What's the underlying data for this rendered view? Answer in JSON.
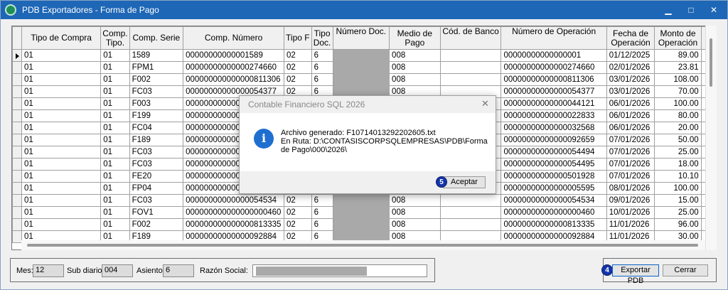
{
  "window": {
    "title": "PDB Exportadores - Forma de Pago",
    "controls": {
      "minimize": "▁",
      "maximize": "□",
      "close": "✕"
    }
  },
  "grid": {
    "columns": [
      "Tipo de Compra",
      "Comp. Tipo.",
      "Comp. Serie",
      "Comp. Número",
      "Tipo F",
      "Tipo Doc.",
      "Número Doc.",
      "Medio de Pago",
      "Cód. de Banco",
      "Número de Operación",
      "Fecha de Operación",
      "Monto de Operación"
    ],
    "rows": [
      [
        "01",
        "01",
        "1589",
        "00000000000001589",
        "02",
        "6",
        "",
        "008",
        "",
        "00000000000000001",
        "01/12/2025",
        "89.00"
      ],
      [
        "01",
        "01",
        "FPM1",
        "00000000000000274660",
        "02",
        "6",
        "",
        "008",
        "",
        "00000000000000274660",
        "02/01/2026",
        "23.81"
      ],
      [
        "01",
        "01",
        "F002",
        "000000000000000811306",
        "02",
        "6",
        "",
        "008",
        "",
        "00000000000000811306",
        "03/01/2026",
        "108.00"
      ],
      [
        "01",
        "01",
        "FC03",
        "00000000000000054377",
        "02",
        "6",
        "",
        "008",
        "",
        "00000000000000054377",
        "03/01/2026",
        "70.00"
      ],
      [
        "01",
        "01",
        "F003",
        "000000000000",
        "",
        "",
        "",
        "",
        "",
        "00000000000000044121",
        "06/01/2026",
        "100.00"
      ],
      [
        "01",
        "01",
        "F199",
        "000000000000",
        "",
        "",
        "",
        "",
        "",
        "00000000000000022833",
        "06/01/2026",
        "80.00"
      ],
      [
        "01",
        "01",
        "FC04",
        "000000000000",
        "",
        "",
        "",
        "",
        "",
        "00000000000000032568",
        "06/01/2026",
        "20.00"
      ],
      [
        "01",
        "01",
        "F189",
        "000000000000",
        "",
        "",
        "",
        "",
        "",
        "00000000000000092659",
        "07/01/2026",
        "50.00"
      ],
      [
        "01",
        "01",
        "FC03",
        "000000000000",
        "",
        "",
        "",
        "",
        "",
        "00000000000000054494",
        "07/01/2026",
        "25.00"
      ],
      [
        "01",
        "01",
        "FC03",
        "000000000000",
        "",
        "",
        "",
        "",
        "",
        "00000000000000054495",
        "07/01/2026",
        "18.00"
      ],
      [
        "01",
        "01",
        "FE20",
        "000000000000",
        "",
        "",
        "",
        "",
        "",
        "00000000000000501928",
        "07/01/2026",
        "10.10"
      ],
      [
        "01",
        "01",
        "FP04",
        "000000000000",
        "",
        "",
        "",
        "",
        "",
        "00000000000000005595",
        "08/01/2026",
        "100.00"
      ],
      [
        "01",
        "01",
        "FC03",
        "00000000000000054534",
        "02",
        "6",
        "",
        "008",
        "",
        "00000000000000054534",
        "09/01/2026",
        "15.00"
      ],
      [
        "01",
        "01",
        "FOV1",
        "000000000000000000460",
        "02",
        "6",
        "",
        "008",
        "",
        "00000000000000000460",
        "10/01/2026",
        "25.00"
      ],
      [
        "01",
        "01",
        "F002",
        "000000000000000813335",
        "02",
        "6",
        "",
        "008",
        "",
        "00000000000000813335",
        "11/01/2026",
        "96.00"
      ],
      [
        "01",
        "01",
        "F189",
        "00000000000000092884",
        "02",
        "6",
        "",
        "008",
        "",
        "00000000000000092884",
        "11/01/2026",
        "30.00"
      ]
    ]
  },
  "footer": {
    "mes_label": "Mes:",
    "mes_value": "12",
    "subdiario_label": "Sub diario:",
    "subdiario_value": "004",
    "asiento_label": "Asiento:",
    "asiento_value": "6",
    "razon_label": "Razón Social:"
  },
  "buttons": {
    "export_label": "Exportar PDB",
    "close_label": "Cerrar",
    "export_badge": "4"
  },
  "dialog": {
    "title": "Contable Financiero SQL 2026",
    "close": "✕",
    "icon_glyph": "i",
    "line1": "Archivo generado: F10714013292202605.txt",
    "line2": "En Ruta: D:\\CONTASISCORPSQLEMPRESAS\\PDB\\Forma de Pago\\000\\2026\\",
    "accept_label": "Aceptar",
    "accept_badge": "5"
  },
  "icons": {
    "app": "app-logo-icon",
    "info": "info-icon",
    "row_pointer": "row-pointer-icon"
  }
}
